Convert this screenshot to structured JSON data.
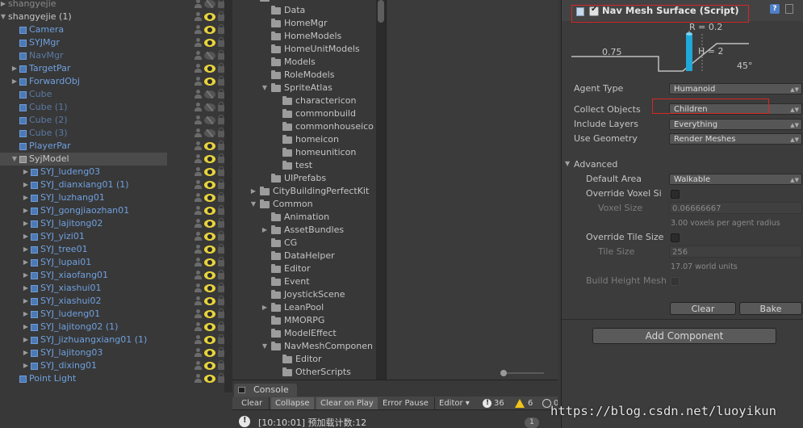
{
  "hierarchy": {
    "rows": [
      {
        "name": "shangyejie",
        "indent": 0,
        "arrow": "right",
        "kind": "plain",
        "eye": "off"
      },
      {
        "name": "shangyejie (1)",
        "indent": 0,
        "arrow": "down",
        "kind": "plain",
        "eye": "on"
      },
      {
        "name": "Camera",
        "indent": 1,
        "arrow": "",
        "kind": "prefab",
        "eye": "on"
      },
      {
        "name": "SYJMgr",
        "indent": 1,
        "arrow": "",
        "kind": "prefab",
        "eye": "on"
      },
      {
        "name": "NavMgr",
        "indent": 1,
        "arrow": "",
        "kind": "inactive",
        "eye": "off"
      },
      {
        "name": "TargetPar",
        "indent": 1,
        "arrow": "right",
        "kind": "prefab",
        "eye": "on"
      },
      {
        "name": "ForwardObj",
        "indent": 1,
        "arrow": "right",
        "kind": "prefab",
        "eye": "on"
      },
      {
        "name": "Cube",
        "indent": 1,
        "arrow": "",
        "kind": "inactive",
        "eye": "off"
      },
      {
        "name": "Cube (1)",
        "indent": 1,
        "arrow": "",
        "kind": "inactive",
        "eye": "off"
      },
      {
        "name": "Cube (2)",
        "indent": 1,
        "arrow": "",
        "kind": "inactive",
        "eye": "off"
      },
      {
        "name": "Cube (3)",
        "indent": 1,
        "arrow": "",
        "kind": "inactive",
        "eye": "off"
      },
      {
        "name": "PlayerPar",
        "indent": 1,
        "arrow": "",
        "kind": "prefab",
        "eye": "on"
      },
      {
        "name": "SyjModel",
        "indent": 1,
        "arrow": "down",
        "kind": "selected",
        "eye": "on"
      },
      {
        "name": "SYJ_ludeng03",
        "indent": 2,
        "arrow": "right",
        "kind": "prefab",
        "eye": "on"
      },
      {
        "name": "SYJ_dianxiang01 (1)",
        "indent": 2,
        "arrow": "right",
        "kind": "prefab",
        "eye": "on"
      },
      {
        "name": "SYJ_luzhang01",
        "indent": 2,
        "arrow": "right",
        "kind": "prefab",
        "eye": "on"
      },
      {
        "name": "SYJ_gongjiaozhan01",
        "indent": 2,
        "arrow": "right",
        "kind": "prefab",
        "eye": "on"
      },
      {
        "name": "SYJ_lajitong02",
        "indent": 2,
        "arrow": "right",
        "kind": "prefab",
        "eye": "on"
      },
      {
        "name": "SYJ_yizi01",
        "indent": 2,
        "arrow": "right",
        "kind": "prefab",
        "eye": "on"
      },
      {
        "name": "SYJ_tree01",
        "indent": 2,
        "arrow": "right",
        "kind": "prefab",
        "eye": "on"
      },
      {
        "name": "SYJ_lupai01",
        "indent": 2,
        "arrow": "right",
        "kind": "prefab",
        "eye": "on"
      },
      {
        "name": "SYJ_xiaofang01",
        "indent": 2,
        "arrow": "right",
        "kind": "prefab",
        "eye": "on"
      },
      {
        "name": "SYJ_xiashui01",
        "indent": 2,
        "arrow": "right",
        "kind": "prefab",
        "eye": "on"
      },
      {
        "name": "SYJ_xiashui02",
        "indent": 2,
        "arrow": "right",
        "kind": "prefab",
        "eye": "on"
      },
      {
        "name": "SYJ_ludeng01",
        "indent": 2,
        "arrow": "right",
        "kind": "prefab",
        "eye": "on"
      },
      {
        "name": "SYJ_lajitong02 (1)",
        "indent": 2,
        "arrow": "right",
        "kind": "prefab",
        "eye": "on"
      },
      {
        "name": "SYJ_jizhuangxiang01 (1)",
        "indent": 2,
        "arrow": "right",
        "kind": "prefab",
        "eye": "on"
      },
      {
        "name": "SYJ_lajitong03",
        "indent": 2,
        "arrow": "right",
        "kind": "prefab",
        "eye": "on"
      },
      {
        "name": "SYJ_dixing01",
        "indent": 2,
        "arrow": "right",
        "kind": "prefab",
        "eye": "on"
      },
      {
        "name": "Point Light",
        "indent": 1,
        "arrow": "",
        "kind": "prefab",
        "eye": "on"
      }
    ]
  },
  "project": {
    "folders": [
      {
        "name": "",
        "indent": 1,
        "arrow": "down"
      },
      {
        "name": "Data",
        "indent": 2,
        "arrow": ""
      },
      {
        "name": "HomeMgr",
        "indent": 2,
        "arrow": ""
      },
      {
        "name": "HomeModels",
        "indent": 2,
        "arrow": ""
      },
      {
        "name": "HomeUnitModels",
        "indent": 2,
        "arrow": ""
      },
      {
        "name": "Models",
        "indent": 2,
        "arrow": ""
      },
      {
        "name": "RoleModels",
        "indent": 2,
        "arrow": ""
      },
      {
        "name": "SpriteAtlas",
        "indent": 2,
        "arrow": "down"
      },
      {
        "name": "charactericon",
        "indent": 3,
        "arrow": ""
      },
      {
        "name": "commonbuild",
        "indent": 3,
        "arrow": ""
      },
      {
        "name": "commonhouseico",
        "indent": 3,
        "arrow": ""
      },
      {
        "name": "homeicon",
        "indent": 3,
        "arrow": ""
      },
      {
        "name": "homeuniticon",
        "indent": 3,
        "arrow": ""
      },
      {
        "name": "test",
        "indent": 3,
        "arrow": ""
      },
      {
        "name": "UIPrefabs",
        "indent": 2,
        "arrow": ""
      },
      {
        "name": "CityBuildingPerfectKit",
        "indent": 1,
        "arrow": "right"
      },
      {
        "name": "Common",
        "indent": 1,
        "arrow": "down"
      },
      {
        "name": "Animation",
        "indent": 2,
        "arrow": ""
      },
      {
        "name": "AssetBundles",
        "indent": 2,
        "arrow": "right"
      },
      {
        "name": "CG",
        "indent": 2,
        "arrow": ""
      },
      {
        "name": "DataHelper",
        "indent": 2,
        "arrow": ""
      },
      {
        "name": "Editor",
        "indent": 2,
        "arrow": ""
      },
      {
        "name": "Event",
        "indent": 2,
        "arrow": ""
      },
      {
        "name": "JoystickScene",
        "indent": 2,
        "arrow": ""
      },
      {
        "name": "LeanPool",
        "indent": 2,
        "arrow": "right"
      },
      {
        "name": "MMORPG",
        "indent": 2,
        "arrow": ""
      },
      {
        "name": "ModelEffect",
        "indent": 2,
        "arrow": ""
      },
      {
        "name": "NavMeshComponen",
        "indent": 2,
        "arrow": "down"
      },
      {
        "name": "Editor",
        "indent": 3,
        "arrow": ""
      },
      {
        "name": "OtherScripts",
        "indent": 3,
        "arrow": ""
      }
    ]
  },
  "console": {
    "tab_label": "Console",
    "clear_label": "Clear",
    "collapse_label": "Collapse",
    "clear_on_play_label": "Clear on Play",
    "error_pause_label": "Error Pause",
    "editor_label": "Editor",
    "log_count": "36",
    "warn_count": "6",
    "error_count": "0",
    "entry_text": "[10:10:01] 预加载计数:12",
    "entry_count": "1"
  },
  "inspector": {
    "component_title": "Nav Mesh Surface (Script)",
    "help_glyph": "?",
    "diagram": {
      "radius_label": "R = 0.2",
      "height_label": "H = 2",
      "step_label": "0.75",
      "slope_label": "45°"
    },
    "agent_type_label": "Agent Type",
    "agent_type_value": "Humanoid",
    "collect_objects_label": "Collect Objects",
    "collect_objects_value": "Children",
    "include_layers_label": "Include Layers",
    "include_layers_value": "Everything",
    "use_geometry_label": "Use Geometry",
    "use_geometry_value": "Render Meshes",
    "advanced_label": "Advanced",
    "default_area_label": "Default Area",
    "default_area_value": "Walkable",
    "override_voxel_label": "Override Voxel Si",
    "voxel_size_label": "Voxel Size",
    "voxel_size_value": "0.06666667",
    "voxel_hint": "3.00 voxels per agent radius",
    "override_tile_label": "Override Tile Size",
    "tile_size_label": "Tile Size",
    "tile_size_value": "256",
    "tile_hint": "17.07 world units",
    "build_height_label": "Build Height Mesh",
    "clear_button": "Clear",
    "bake_button": "Bake",
    "add_component_button": "Add Component"
  },
  "watermark": "https://blog.csdn.net/luoyikun",
  "colors": {
    "prefab_text": "#6fa0df",
    "highlight_box": "#d62828",
    "nav_agent": "#1fa8d8",
    "visible_eye": "#e8d43c"
  }
}
